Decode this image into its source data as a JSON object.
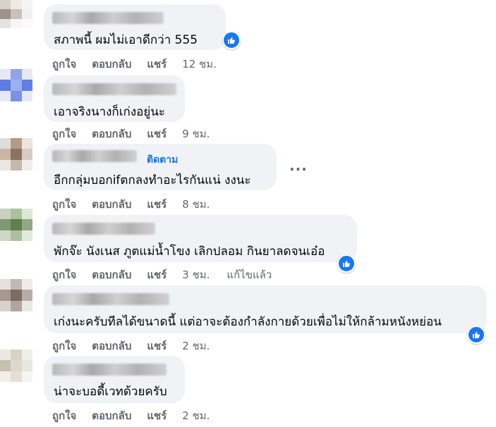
{
  "actions": {
    "like": "ถูกใจ",
    "reply": "ตอบกลับ",
    "share": "แชร์",
    "edited": "แก้ไขแล้ว"
  },
  "comments": [
    {
      "text": "สภาพนี้ ผมไม่เอาดีกว่า 555",
      "time": "12 ชม."
    },
    {
      "text": "เอาจริงนางก็เก่งอยู่นะ",
      "time": "9 ชม."
    },
    {
      "text": "อีกกลุ่มบอกifตกลงทำอะไรกันแน่ งงนะ",
      "time": "8 ชม.",
      "follow": "ติดตาม"
    },
    {
      "text": "พักจ๊ะ นังเนส ภูตแม่น้ำโขง เลิกปลอม กินยาลดจนเอ๋อ",
      "time": "3 ชม."
    },
    {
      "text": "เก่งนะครับทีลได้ขนาดนี้ แต่อาจะต้องกำลังกายด้วยเพื่อไม่ให้กล้ามหนังหย่อน",
      "time": "2 ชม."
    },
    {
      "text": "น่าจะบอดี้เวทด้วยครับ",
      "time": "2 ชม."
    }
  ],
  "colors": {
    "bubble": "#f0f2f5",
    "meta": "#65676b",
    "link": "#1b74e4",
    "like_badge": "#1877f2"
  },
  "icons": {
    "reaction": "thumbs-up-icon",
    "more": "more-dots-icon"
  }
}
